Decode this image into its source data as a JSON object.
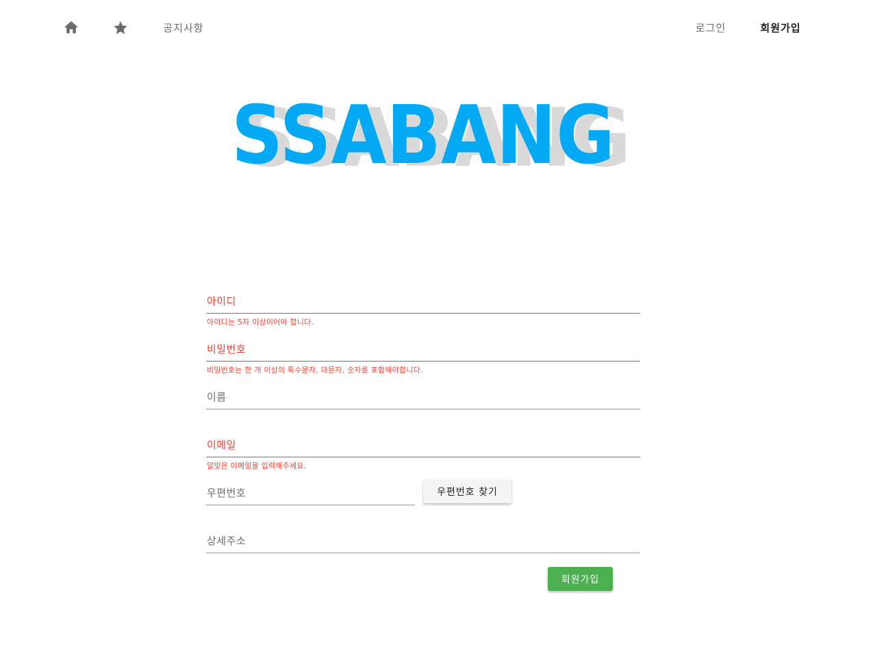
{
  "nav": {
    "home_icon": "home-icon",
    "star_icon": "star-icon",
    "notice_label": "공지사항",
    "login_label": "로그인",
    "signup_label": "회원가입"
  },
  "logo": {
    "text": "SSABANG",
    "color": "#03a9f4",
    "shadow_color": "#d9d9d9"
  },
  "form": {
    "id": {
      "placeholder": "아이디",
      "value": "",
      "error": "아이디는 5자 이상이어야 합니다."
    },
    "password": {
      "placeholder": "비밀번호",
      "value": "",
      "error": "비밀번호는 한 개 이상의 특수문자, 대문자, 숫자를 포함해야합니다."
    },
    "name": {
      "placeholder": "이름",
      "value": ""
    },
    "email": {
      "placeholder": "이메일",
      "value": "",
      "error": "알맞은 이메일을 입력해주세요."
    },
    "zipcode": {
      "placeholder": "우편번호",
      "value": "",
      "button_label": "우편번호 찾기"
    },
    "address": {
      "placeholder": "상세주소",
      "value": ""
    },
    "submit_label": "회원가입"
  },
  "colors": {
    "error": "#f44336",
    "submit": "#4caf50",
    "underline": "#9a9a9a"
  }
}
